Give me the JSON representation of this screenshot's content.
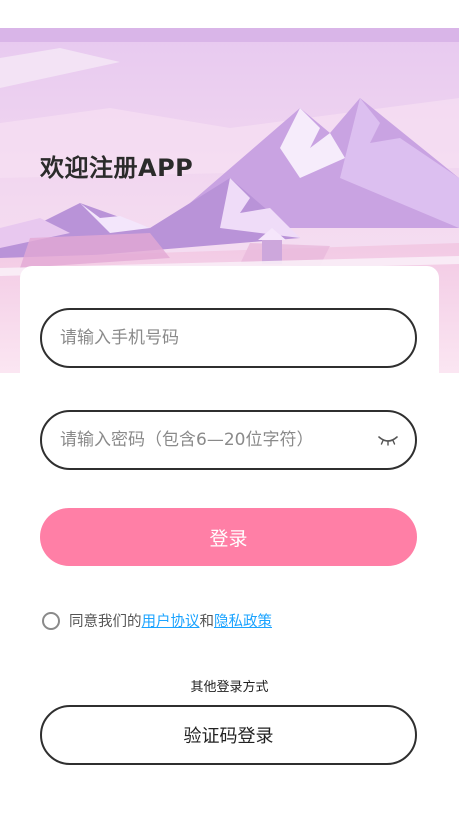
{
  "header": {
    "title": "欢迎注册APP"
  },
  "form": {
    "phone_placeholder": "请输入手机号码",
    "password_placeholder": "请输入密码（包含6—20位字符）",
    "login_label": "登录"
  },
  "agreement": {
    "prefix": "同意我们的",
    "user_agreement": "用户协议",
    "conjunction": "和",
    "privacy_policy": "隐私政策"
  },
  "other_login": {
    "label": "其他登录方式",
    "code_login_label": "验证码登录"
  },
  "colors": {
    "accent": "#ff7fa6",
    "link": "#1aa3ff",
    "border": "#2f2f2f"
  },
  "icons": {
    "password_toggle": "eye-closed-icon"
  }
}
